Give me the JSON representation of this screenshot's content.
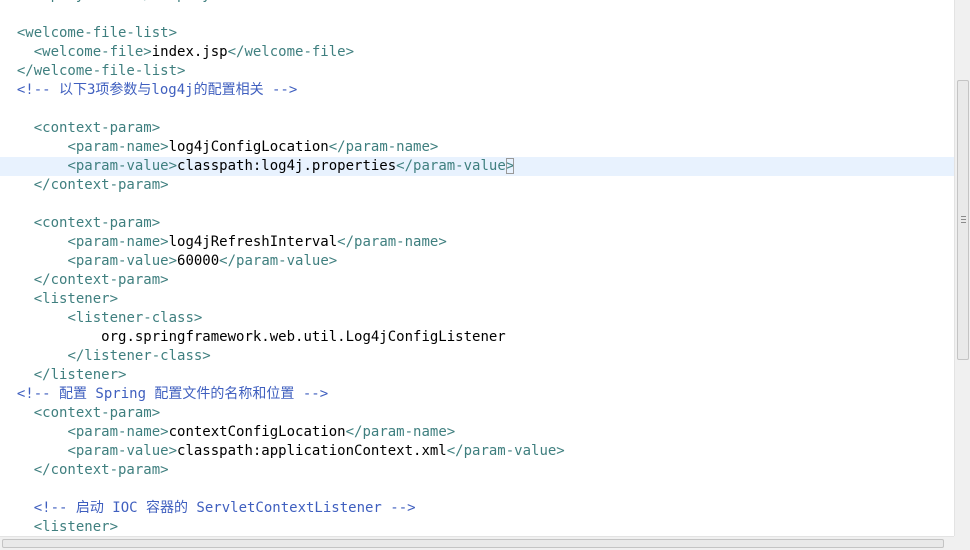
{
  "editor": {
    "lines": [
      {
        "indent": "  ",
        "segments": [
          {
            "t": "<display-name></display-name>",
            "c": "tag"
          }
        ]
      },
      {
        "indent": "",
        "segments": []
      },
      {
        "indent": "  ",
        "segments": [
          {
            "t": "<welcome-file-list>",
            "c": "tag"
          }
        ]
      },
      {
        "indent": "    ",
        "segments": [
          {
            "t": "<welcome-file>",
            "c": "tag"
          },
          {
            "t": "index.jsp",
            "c": "txt"
          },
          {
            "t": "</welcome-file>",
            "c": "tag"
          }
        ]
      },
      {
        "indent": "  ",
        "segments": [
          {
            "t": "</welcome-file-list>",
            "c": "tag"
          }
        ]
      },
      {
        "indent": "  ",
        "segments": [
          {
            "t": "<!-- 以下3项参数与log4j的配置相关 -->",
            "c": "cmt"
          }
        ]
      },
      {
        "indent": "",
        "segments": []
      },
      {
        "indent": "    ",
        "segments": [
          {
            "t": "<context-param>",
            "c": "tag"
          }
        ]
      },
      {
        "indent": "        ",
        "segments": [
          {
            "t": "<param-name>",
            "c": "tag"
          },
          {
            "t": "log4jConfigLocation",
            "c": "txt"
          },
          {
            "t": "</param-name>",
            "c": "tag"
          }
        ]
      },
      {
        "indent": "        ",
        "current": true,
        "segments": [
          {
            "t": "<param-value>",
            "c": "tag"
          },
          {
            "t": "classpath:log4j.properties",
            "c": "txt"
          },
          {
            "t": "</param-value",
            "c": "tag"
          },
          {
            "t": ">",
            "c": "tag",
            "box": true
          }
        ]
      },
      {
        "indent": "    ",
        "segments": [
          {
            "t": "</context-param>",
            "c": "tag"
          }
        ]
      },
      {
        "indent": "",
        "segments": []
      },
      {
        "indent": "    ",
        "segments": [
          {
            "t": "<context-param>",
            "c": "tag"
          }
        ]
      },
      {
        "indent": "        ",
        "segments": [
          {
            "t": "<param-name>",
            "c": "tag"
          },
          {
            "t": "log4jRefreshInterval",
            "c": "txt"
          },
          {
            "t": "</param-name>",
            "c": "tag"
          }
        ]
      },
      {
        "indent": "        ",
        "segments": [
          {
            "t": "<param-value>",
            "c": "tag"
          },
          {
            "t": "60000",
            "c": "txt"
          },
          {
            "t": "</param-value>",
            "c": "tag"
          }
        ]
      },
      {
        "indent": "    ",
        "segments": [
          {
            "t": "</context-param>",
            "c": "tag"
          }
        ]
      },
      {
        "indent": "    ",
        "segments": [
          {
            "t": "<listener>",
            "c": "tag"
          }
        ]
      },
      {
        "indent": "        ",
        "segments": [
          {
            "t": "<listener-class>",
            "c": "tag"
          }
        ]
      },
      {
        "indent": "            ",
        "segments": [
          {
            "t": "org.springframework.web.util.Log4jConfigListener",
            "c": "txt"
          }
        ]
      },
      {
        "indent": "        ",
        "segments": [
          {
            "t": "</listener-class>",
            "c": "tag"
          }
        ]
      },
      {
        "indent": "    ",
        "segments": [
          {
            "t": "</listener>",
            "c": "tag"
          }
        ]
      },
      {
        "indent": "  ",
        "segments": [
          {
            "t": "<!-- 配置 Spring 配置文件的名称和位置 -->",
            "c": "cmt"
          }
        ]
      },
      {
        "indent": "    ",
        "segments": [
          {
            "t": "<context-param>",
            "c": "tag"
          }
        ]
      },
      {
        "indent": "        ",
        "segments": [
          {
            "t": "<param-name>",
            "c": "tag"
          },
          {
            "t": "contextConfigLocation",
            "c": "txt"
          },
          {
            "t": "</param-name>",
            "c": "tag"
          }
        ]
      },
      {
        "indent": "        ",
        "segments": [
          {
            "t": "<param-value>",
            "c": "tag"
          },
          {
            "t": "classpath:applicationContext.xml",
            "c": "txt"
          },
          {
            "t": "</param-value>",
            "c": "tag"
          }
        ]
      },
      {
        "indent": "    ",
        "segments": [
          {
            "t": "</context-param>",
            "c": "tag"
          }
        ]
      },
      {
        "indent": "",
        "segments": []
      },
      {
        "indent": "    ",
        "segments": [
          {
            "t": "<!-- 启动 IOC 容器的 ServletContextListener -->",
            "c": "cmt"
          }
        ]
      },
      {
        "indent": "    ",
        "segments": [
          {
            "t": "<listener>",
            "c": "tag"
          }
        ]
      }
    ]
  },
  "colors": {
    "tag": "#3f7f7f",
    "text": "#000000",
    "comment": "#3f5fbf",
    "current_line": "#e8f2fe"
  }
}
